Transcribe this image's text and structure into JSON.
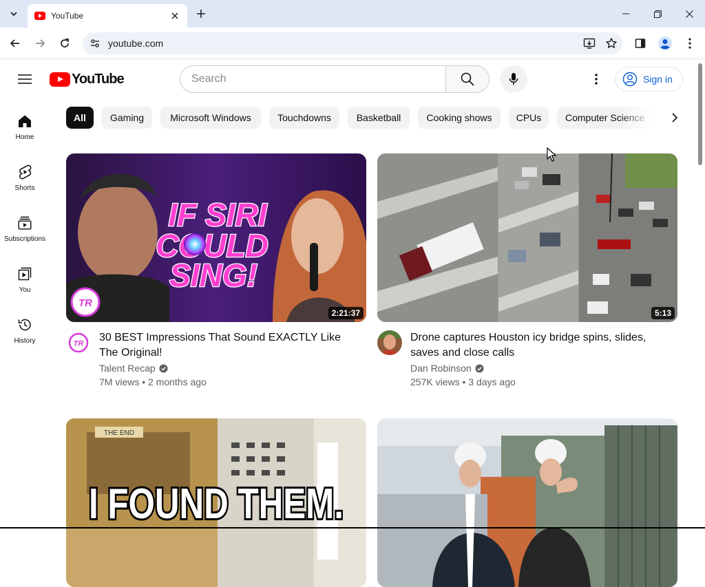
{
  "browser": {
    "tab_title": "YouTube",
    "url": "youtube.com"
  },
  "masthead": {
    "logo_text": "YouTube",
    "search_placeholder": "Search",
    "signin_label": "Sign in"
  },
  "guide": {
    "items": [
      {
        "label": "Home",
        "icon": "home-icon"
      },
      {
        "label": "Shorts",
        "icon": "shorts-icon"
      },
      {
        "label": "Subscriptions",
        "icon": "subscriptions-icon"
      },
      {
        "label": "You",
        "icon": "you-icon"
      },
      {
        "label": "History",
        "icon": "history-icon"
      }
    ]
  },
  "chips": [
    {
      "label": "All",
      "active": true
    },
    {
      "label": "Gaming"
    },
    {
      "label": "Microsoft Windows"
    },
    {
      "label": "Touchdowns"
    },
    {
      "label": "Basketball"
    },
    {
      "label": "Cooking shows"
    },
    {
      "label": "CPUs"
    },
    {
      "label": "Computer Science"
    }
  ],
  "videos": [
    {
      "title": "30 BEST Impressions That Sound EXACTLY Like The Original!",
      "channel": "Talent Recap",
      "views": "7M views",
      "age": "2 months ago",
      "stats": "7M views • 2 months ago",
      "duration": "2:21:37",
      "thumb_text_line1": "IF SIRI",
      "thumb_text_line2": "COULD",
      "thumb_text_line3": "SING!",
      "badge_text": "TR"
    },
    {
      "title": "Drone captures Houston icy bridge spins, slides, saves and close calls",
      "channel": "Dan Robinson",
      "views": "257K views",
      "age": "3 days ago",
      "stats": "257K views • 3 days ago",
      "duration": "5:13"
    },
    {
      "title": "",
      "thumb_text": "I FOUND THEM.",
      "thumb_sign": "THE END"
    },
    {
      "title": ""
    }
  ],
  "colors": {
    "brand_red": "#ff0000",
    "link_blue": "#065fd4",
    "chrome_bg": "#dfe7f5"
  }
}
